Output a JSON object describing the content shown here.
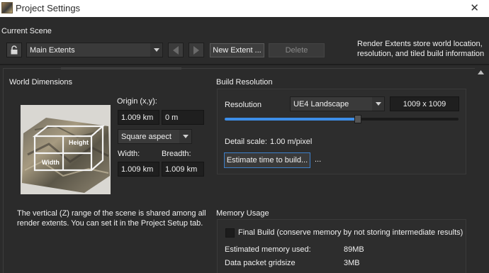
{
  "window": {
    "title": "Project Settings",
    "close_glyph": "✕"
  },
  "scene": {
    "label": "Current Scene",
    "extent_selected": "Main Extents",
    "new_extent_label": "New Extent ...",
    "delete_label": "Delete",
    "info": "Render Extents store world location, resolution, and tiled build information"
  },
  "world": {
    "heading": "World Dimensions",
    "origin_label": "Origin (x,y):",
    "origin_x": "1.009 km",
    "origin_y": "0 m",
    "aspect_selected": "Square aspect",
    "width_label": "Width:",
    "breadth_label": "Breadth:",
    "width_value": "1.009 km",
    "breadth_value": "1.009 km",
    "diagram_height": "Height",
    "diagram_width": "Width",
    "description": "The vertical (Z) range of the scene is shared among all render extents. You can set it in the Project Setup tab."
  },
  "build": {
    "heading": "Build Resolution",
    "resolution_label": "Resolution",
    "resolution_selected": "UE4 Landscape",
    "resolution_size": "1009 x 1009",
    "slider_level": 0.57,
    "detail_label": "Detail scale:",
    "detail_value": "1.00 m/pixel",
    "estimate_label": "Estimate time to build...",
    "more_label": "..."
  },
  "memory": {
    "heading": "Memory Usage",
    "final_build_label": "Final Build (conserve memory by not storing intermediate results)",
    "final_build_checked": false,
    "estimated_label": "Estimated memory used:",
    "estimated_value": "89MB",
    "gridsize_label": "Data packet gridsize",
    "gridsize_value": "3MB"
  },
  "colors": {
    "accent": "#3d8ee8",
    "background": "#2b2b2b",
    "field": "#1f1f1f"
  }
}
